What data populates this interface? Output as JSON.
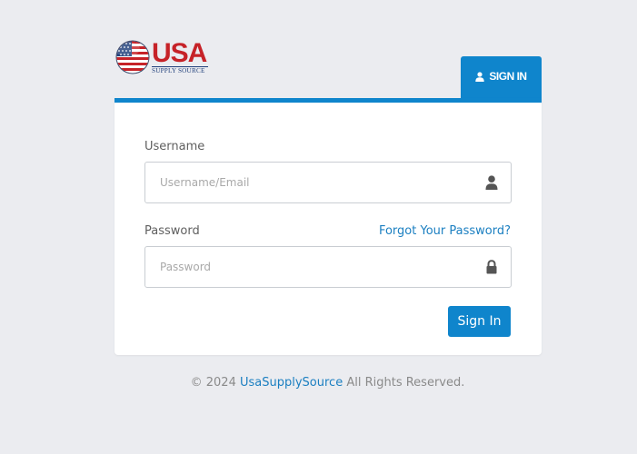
{
  "brand": {
    "logo_main": "USA",
    "logo_sub": "SUPPLY SOURCE",
    "colors": {
      "red": "#c62228",
      "blue": "#1f3f7a",
      "accent": "#0f85cc"
    }
  },
  "tab": {
    "icon": "user-icon",
    "label": "SIGN IN"
  },
  "form": {
    "username": {
      "label": "Username",
      "placeholder": "Username/Email",
      "value": "",
      "icon": "user-icon"
    },
    "password": {
      "label": "Password",
      "placeholder": "Password",
      "value": "",
      "icon": "lock-icon"
    },
    "forgot_link": "Forgot Your Password?",
    "submit_label": "Sign In"
  },
  "footer": {
    "prefix": "© 2024",
    "link": "UsaSupplySource",
    "suffix": "All Rights Reserved."
  }
}
